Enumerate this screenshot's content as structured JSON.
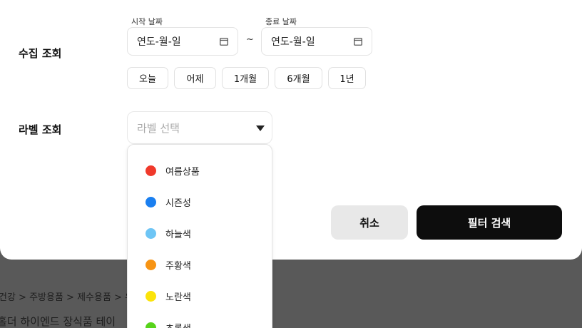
{
  "background": {
    "breadcrumb": "건강 > 주방용품 > 제수용품 > 유",
    "product_title": "홀더 하이엔드 장식품 테이"
  },
  "filter": {
    "collection": {
      "label": "수집 조회",
      "start_caption": "시작 날짜",
      "end_caption": "종료 날짜",
      "start_placeholder": "연도-월-일",
      "end_placeholder": "연도-월-일",
      "separator": "~",
      "quick_ranges": [
        "오늘",
        "어제",
        "1개월",
        "6개월",
        "1년"
      ]
    },
    "label_filter": {
      "label": "라벨 조회",
      "placeholder": "라벨 선택",
      "options": [
        {
          "name": "여름상품",
          "color": "#f0392b"
        },
        {
          "name": "시즌성",
          "color": "#1a7ff0"
        },
        {
          "name": "하늘색",
          "color": "#6ec5f5"
        },
        {
          "name": "주황색",
          "color": "#f79414"
        },
        {
          "name": "노란색",
          "color": "#fbe30a"
        },
        {
          "name": "초록색",
          "color": "#57d31b"
        }
      ]
    },
    "actions": {
      "cancel": "취소",
      "search": "필터 검색"
    }
  }
}
